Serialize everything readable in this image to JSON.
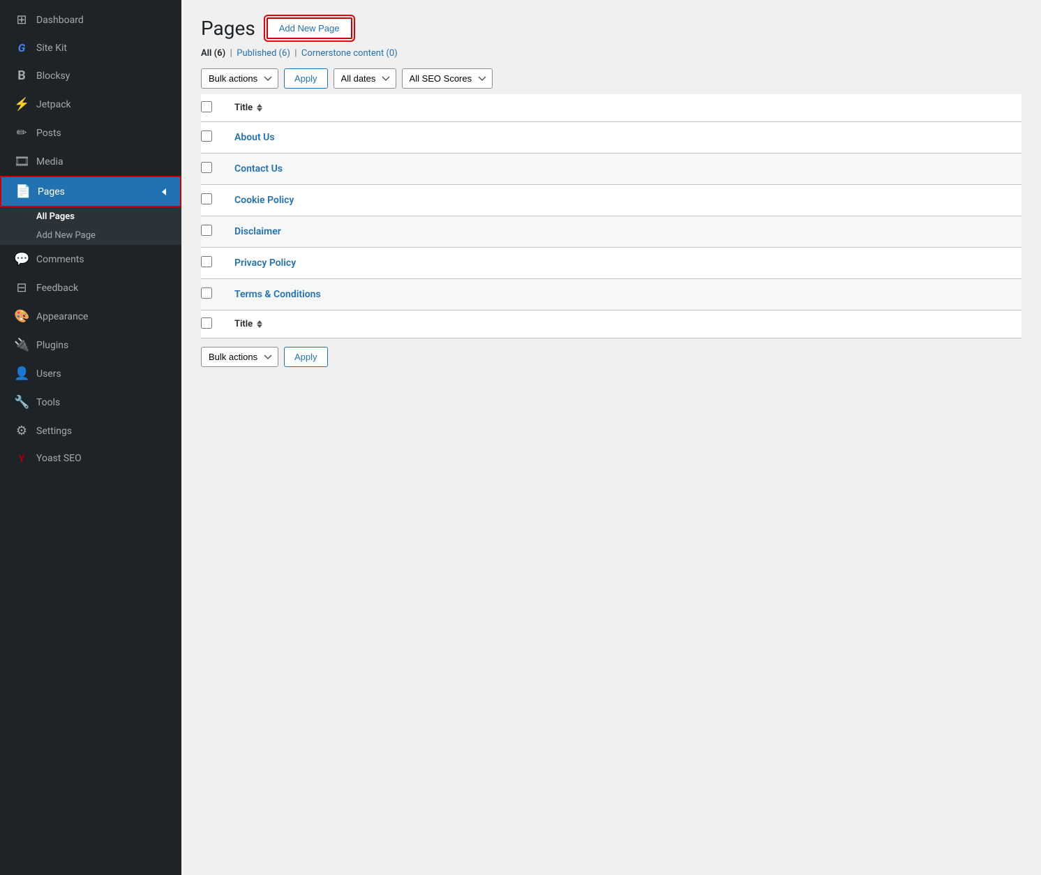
{
  "sidebar": {
    "items": [
      {
        "id": "dashboard",
        "label": "Dashboard",
        "icon": "⊞"
      },
      {
        "id": "sitekit",
        "label": "Site Kit",
        "icon": "G"
      },
      {
        "id": "blocksy",
        "label": "Blocksy",
        "icon": "🅑"
      },
      {
        "id": "jetpack",
        "label": "Jetpack",
        "icon": "⚡"
      },
      {
        "id": "posts",
        "label": "Posts",
        "icon": "✏"
      },
      {
        "id": "media",
        "label": "Media",
        "icon": "🎞"
      },
      {
        "id": "pages",
        "label": "Pages",
        "icon": "📄",
        "active": true
      },
      {
        "id": "comments",
        "label": "Comments",
        "icon": "💬"
      },
      {
        "id": "feedback",
        "label": "Feedback",
        "icon": "⊟"
      },
      {
        "id": "appearance",
        "label": "Appearance",
        "icon": "🎨"
      },
      {
        "id": "plugins",
        "label": "Plugins",
        "icon": "🔌"
      },
      {
        "id": "users",
        "label": "Users",
        "icon": "👤"
      },
      {
        "id": "tools",
        "label": "Tools",
        "icon": "🔧"
      },
      {
        "id": "settings",
        "label": "Settings",
        "icon": "⚙"
      },
      {
        "id": "yoastseo",
        "label": "Yoast SEO",
        "icon": "Y"
      }
    ],
    "submenu": {
      "all_pages": "All Pages",
      "add_new": "Add New Page"
    }
  },
  "header": {
    "title": "Pages",
    "add_new_label": "Add New Page"
  },
  "filter_tabs": {
    "all_label": "All",
    "all_count": "(6)",
    "published_label": "Published",
    "published_count": "(6)",
    "cornerstone_label": "Cornerstone content",
    "cornerstone_count": "(0)"
  },
  "toolbar": {
    "bulk_actions_label": "Bulk actions",
    "apply_label": "Apply",
    "all_dates_label": "All dates",
    "all_seo_scores_label": "All SEO Scores"
  },
  "table": {
    "header_title": "Title",
    "rows": [
      {
        "id": 1,
        "title": "About Us"
      },
      {
        "id": 2,
        "title": "Contact Us"
      },
      {
        "id": 3,
        "title": "Cookie Policy"
      },
      {
        "id": 4,
        "title": "Disclaimer"
      },
      {
        "id": 5,
        "title": "Privacy Policy"
      },
      {
        "id": 6,
        "title": "Terms & Conditions"
      }
    ]
  },
  "bottom_toolbar": {
    "bulk_actions_label": "Bulk actions",
    "apply_label": "Apply"
  }
}
